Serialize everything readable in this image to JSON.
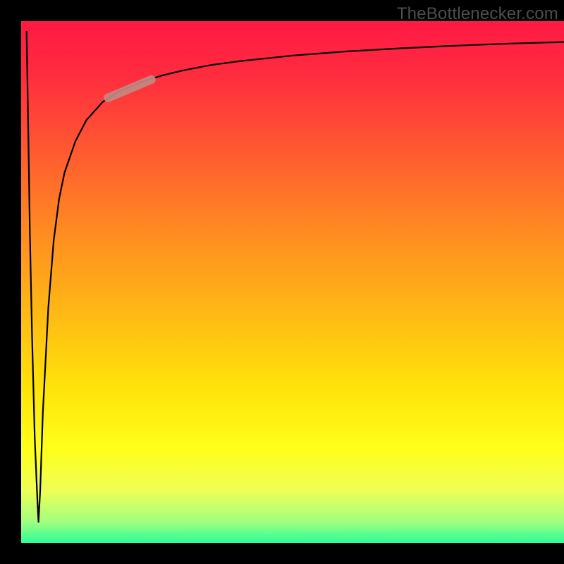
{
  "watermark": "TheBottlenecker.com",
  "colors": {
    "frame": "#000000",
    "gradient_stops": [
      {
        "offset": 0.0,
        "color": "#ff1a44"
      },
      {
        "offset": 0.1,
        "color": "#ff2b3f"
      },
      {
        "offset": 0.25,
        "color": "#ff5a30"
      },
      {
        "offset": 0.4,
        "color": "#ff8a22"
      },
      {
        "offset": 0.55,
        "color": "#ffb615"
      },
      {
        "offset": 0.7,
        "color": "#ffe20a"
      },
      {
        "offset": 0.82,
        "color": "#ffff1a"
      },
      {
        "offset": 0.9,
        "color": "#eeff55"
      },
      {
        "offset": 0.96,
        "color": "#a0ff80"
      },
      {
        "offset": 1.0,
        "color": "#2bff99"
      }
    ],
    "curve": "#000000",
    "highlight": "#c18a82"
  },
  "chart_data": {
    "type": "line",
    "title": "",
    "xlabel": "",
    "ylabel": "",
    "xlim": [
      0,
      100
    ],
    "ylim": [
      0,
      100
    ],
    "grid": false,
    "series": [
      {
        "name": "bottleneck-curve",
        "x": [
          1.0,
          1.3,
          1.6,
          2.0,
          2.5,
          3.0,
          3.2,
          3.5,
          4.0,
          5.0,
          6.0,
          7.0,
          8.0,
          10.0,
          12.0,
          15.0,
          18.0,
          22.0,
          26.0,
          30.0,
          35.0,
          40.0,
          50.0,
          60.0,
          70.0,
          80.0,
          90.0,
          100.0
        ],
        "y": [
          98.0,
          80.0,
          60.0,
          40.0,
          20.0,
          8.0,
          4.0,
          10.0,
          25.0,
          45.0,
          58.0,
          66.0,
          71.0,
          77.0,
          81.0,
          84.5,
          86.5,
          88.3,
          89.6,
          90.6,
          91.6,
          92.3,
          93.4,
          94.2,
          94.8,
          95.3,
          95.7,
          96.0
        ]
      },
      {
        "name": "highlight-segment",
        "x": [
          16.0,
          24.0
        ],
        "y": [
          85.3,
          88.8
        ]
      }
    ],
    "legend": false
  }
}
